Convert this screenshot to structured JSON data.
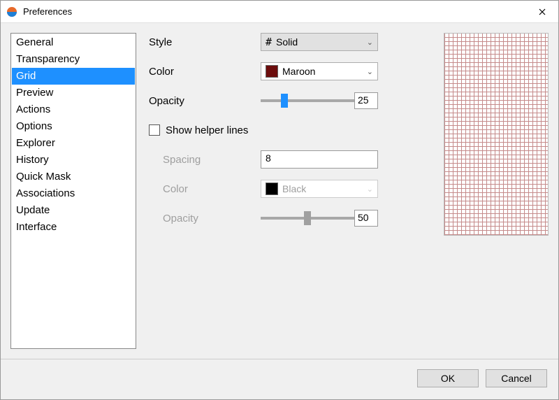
{
  "window": {
    "title": "Preferences"
  },
  "sidebar": {
    "items": [
      {
        "label": "General"
      },
      {
        "label": "Transparency"
      },
      {
        "label": "Grid"
      },
      {
        "label": "Preview"
      },
      {
        "label": "Actions"
      },
      {
        "label": "Options"
      },
      {
        "label": "Explorer"
      },
      {
        "label": "History"
      },
      {
        "label": "Quick Mask"
      },
      {
        "label": "Associations"
      },
      {
        "label": "Update"
      },
      {
        "label": "Interface"
      }
    ],
    "selected_index": 2
  },
  "grid": {
    "style_label": "Style",
    "style_value": "Solid",
    "color_label": "Color",
    "color_value": "Maroon",
    "color_hex": "#6b0c0c",
    "opacity_label": "Opacity",
    "opacity_value": "25",
    "show_helper_label": "Show helper lines",
    "show_helper_checked": false,
    "helper": {
      "spacing_label": "Spacing",
      "spacing_value": "8",
      "color_label": "Color",
      "color_value": "Black",
      "color_hex": "#000000",
      "opacity_label": "Opacity",
      "opacity_value": "50"
    }
  },
  "footer": {
    "ok_label": "OK",
    "cancel_label": "Cancel"
  }
}
